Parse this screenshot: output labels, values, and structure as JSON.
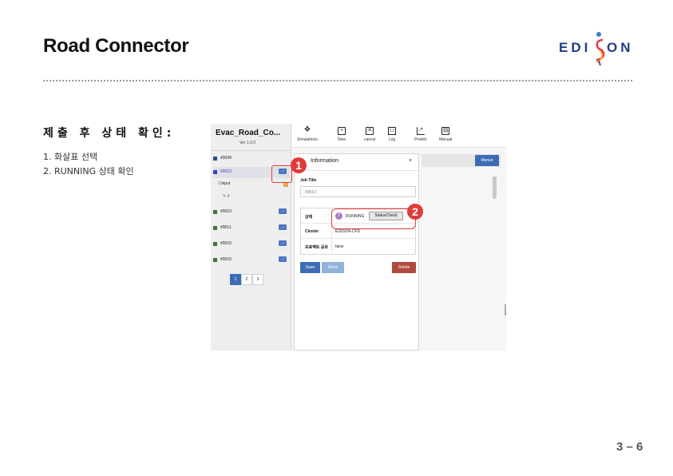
{
  "slide": {
    "title": "Road Connector",
    "logo": {
      "left": "EDI",
      "right": "ON",
      "brand_color": "#1f3c88"
    },
    "heading": "제출 후 상태 확인:",
    "steps": [
      "1. 화살표 선택",
      "2. RUNNING 상태 확인"
    ],
    "page_number": "3 – 6"
  },
  "app": {
    "title": "Evac_Road_Co...",
    "version": "Ver 1.0.0",
    "jobs": [
      {
        "id": "#0034",
        "color": "#2b4c8c"
      },
      {
        "id": "#0013",
        "color": "#3444b8",
        "active": true
      },
      {
        "id": "#0013",
        "color": "#3a7a32"
      },
      {
        "id": "#0011",
        "color": "#3a7a32"
      },
      {
        "id": "#0010",
        "color": "#3a7a32"
      },
      {
        "id": "#0010",
        "color": "#3a7a32"
      }
    ],
    "job_sub": {
      "input_label": "input",
      "result_label": "4",
      "badge": "!"
    },
    "go_icon": "→",
    "pages": [
      "1",
      "2",
      "3"
    ],
    "toolbar": [
      {
        "label": "Simulations",
        "icon": "cubes-icon",
        "glyph": "❖"
      },
      {
        "label": "New",
        "icon": "plus-box-icon",
        "glyph": "+"
      },
      {
        "label": "cancel",
        "icon": "cancel-box-icon",
        "glyph": "✕"
      },
      {
        "label": "Log",
        "icon": "monitor-icon",
        "glyph": "▭"
      },
      {
        "label": "Predict",
        "icon": "line-chart-icon",
        "glyph": "↗"
      },
      {
        "label": "Manual",
        "icon": "book-icon",
        "glyph": "▤"
      }
    ],
    "menu_label": "Menu▾",
    "modal": {
      "title": "Information",
      "close": "×",
      "job_title_label": "Job Title",
      "job_title_value": "#0013",
      "rows": {
        "status_key": "상태",
        "status_value": "RUNNING",
        "status_icon": "!",
        "status_check": "StatusCheck",
        "cluster_key": "Cluster",
        "cluster_value": "EDISON-CFD",
        "share_key": "프로젝트 공유",
        "share_value": "false"
      },
      "buttons": {
        "save": "Save",
        "share": "Share",
        "delete": "Delete"
      }
    },
    "callouts": [
      "1",
      "2"
    ],
    "colors": {
      "primary": "#3d6cb5",
      "share": "#8fb3d9",
      "delete": "#b14a3e",
      "callout": "#e03b3b"
    }
  }
}
